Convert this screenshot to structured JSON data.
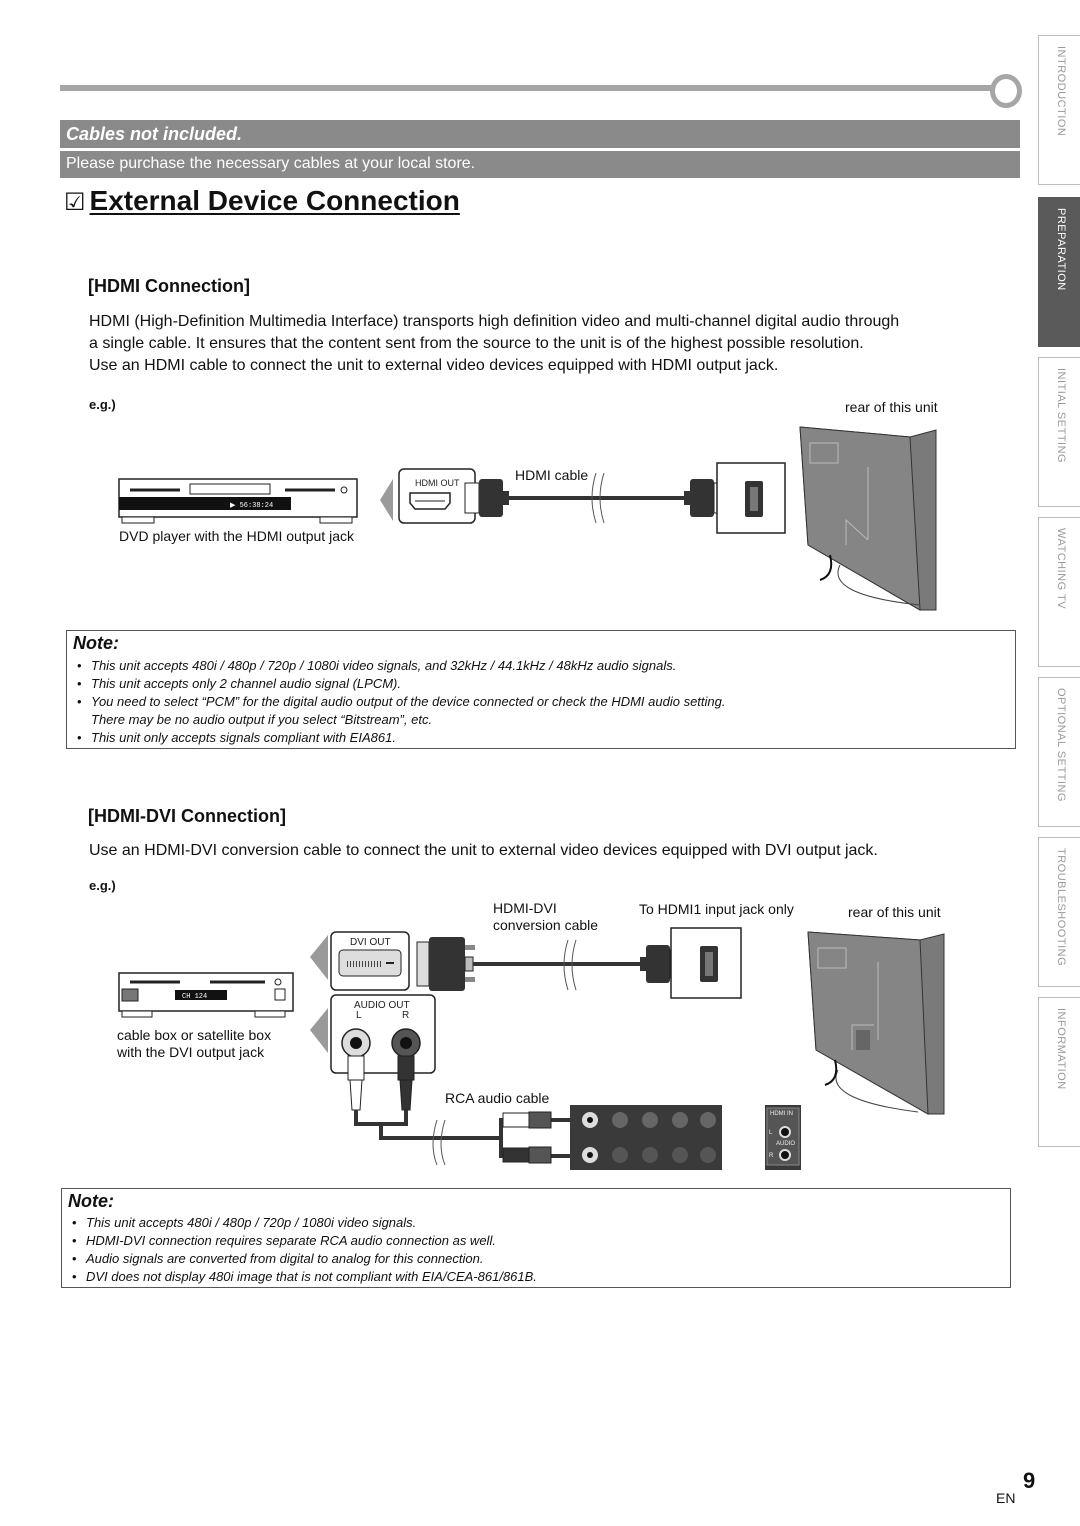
{
  "banner": {
    "title": "Cables not included.",
    "subtitle": "Please purchase the necessary cables at your local store."
  },
  "page_title": {
    "checkbox_glyph": "☑",
    "text": "External Device Connection"
  },
  "side_tabs": [
    {
      "label": "INTRODUCTION",
      "active": false
    },
    {
      "label": "PREPARATION",
      "active": true
    },
    {
      "label": "INITIAL  SETTING",
      "active": false
    },
    {
      "label": "WATCHING  TV",
      "active": false
    },
    {
      "label": "OPTIONAL  SETTING",
      "active": false
    },
    {
      "label": "TROUBLESHOOTING",
      "active": false
    },
    {
      "label": "INFORMATION",
      "active": false
    }
  ],
  "hdmi_section": {
    "heading": "[HDMI Connection]",
    "paragraph_lines": [
      "HDMI (High-Definition Multimedia Interface) transports high definition video and multi-channel digital audio through",
      "a single cable. It ensures that the content sent from the source to the unit is of the highest possible resolution.",
      "Use an HDMI cable to connect the unit to external video devices equipped with HDMI output jack."
    ],
    "eg_label": "e.g.)",
    "diagram": {
      "rear_label": "rear of this unit",
      "cable_label": "HDMI cable",
      "jack_label": "HDMI OUT",
      "device_caption": "DVD player with the HDMI output jack",
      "device_display": "▶ 56:38:24"
    },
    "note": {
      "title": "Note:",
      "items": [
        "This unit accepts 480i / 480p / 720p / 1080i video signals, and 32kHz / 44.1kHz / 48kHz audio signals.",
        "This unit accepts only 2 channel audio signal (LPCM).",
        "You need to select “PCM” for the digital audio output of the device connected or check the HDMI audio setting.",
        "This unit only accepts signals compliant with EIA861."
      ],
      "continuation": "There may be no audio output if you select “Bitstream”, etc."
    }
  },
  "dvi_section": {
    "heading": "[HDMI-DVI Connection]",
    "paragraph": "Use an HDMI-DVI conversion cable to connect the unit to external video devices equipped with DVI output jack.",
    "eg_label": "e.g.)",
    "diagram": {
      "cable_label_1": "HDMI-DVI",
      "cable_label_2": "conversion cable",
      "input_label": "To HDMI1 input jack only",
      "rear_label": "rear of this unit",
      "dvi_jack_label": "DVI OUT",
      "audio_out_label": "AUDIO OUT",
      "audio_l": "L",
      "audio_r": "R",
      "rca_label": "RCA audio cable",
      "device_caption_1": "cable box or satellite box",
      "device_caption_2": "with the DVI output jack",
      "device_display": "CH 124",
      "panel_hdmi_in": "HDMI IN",
      "panel_audio": "AUDIO",
      "panel_l": "L",
      "panel_r": "R"
    },
    "note": {
      "title": "Note:",
      "items": [
        "This unit accepts 480i / 480p / 720p / 1080i video signals.",
        "HDMI-DVI connection requires separate RCA audio connection as well.",
        "Audio signals are converted from digital to analog for this connection.",
        "DVI does not display 480i image that is not compliant with EIA/CEA-861/861B."
      ]
    }
  },
  "footer": {
    "page_number": "9",
    "language": "EN"
  },
  "colors": {
    "banner_gray": "#8a8a8a",
    "active_tab": "#5a5a5a",
    "rule_gray": "#a6a6a6"
  }
}
